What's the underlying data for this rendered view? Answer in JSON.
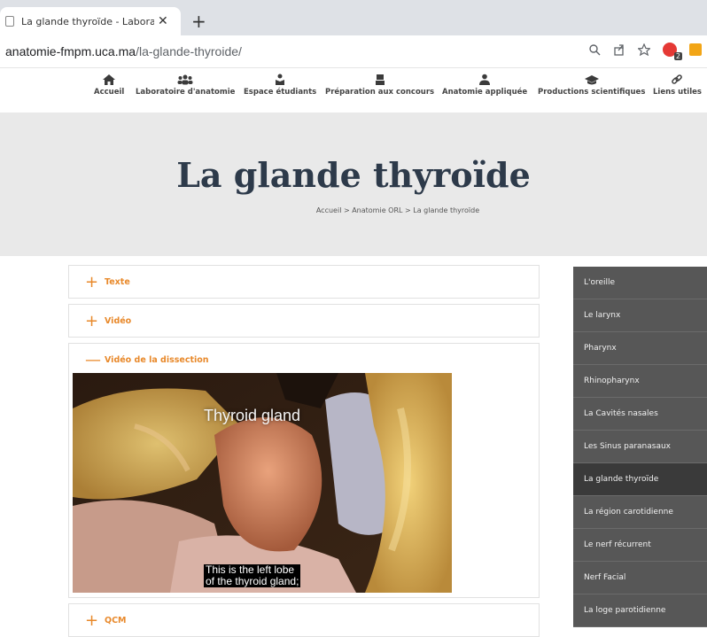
{
  "browser": {
    "tab_title": "La glande thyroïde - Laboratoire",
    "close_glyph": "✕",
    "new_tab_glyph": "+",
    "url_domain": "anatomie-fmpm.uca.ma",
    "url_path": "/la-glande-thyroide/",
    "ext_badge": "2"
  },
  "nav": {
    "items": [
      {
        "label": "Accueil",
        "icon": "home-icon"
      },
      {
        "label": "Laboratoire d'anatomie",
        "icon": "group-icon"
      },
      {
        "label": "Espace étudiants",
        "icon": "student-icon"
      },
      {
        "label": "Préparation aux concours",
        "icon": "exam-icon"
      },
      {
        "label": "Anatomie appliquée",
        "icon": "doctor-icon"
      },
      {
        "label": "Productions scientifiques",
        "icon": "graduation-cap-icon"
      },
      {
        "label": "Liens utiles",
        "icon": "link-icon"
      }
    ]
  },
  "hero": {
    "title": "La glande thyroïde",
    "breadcrumb": "Accueil > Anatomie ORL > La glande thyroïde"
  },
  "accordion": [
    {
      "sign": "+",
      "label": "Texte"
    },
    {
      "sign": "+",
      "label": "Vidéo"
    },
    {
      "sign": "—",
      "label": "Vidéo de la dissection"
    },
    {
      "sign": "+",
      "label": "QCM"
    }
  ],
  "video": {
    "caption_top": "Thyroid gland",
    "caption_line1": "This is the left lobe",
    "caption_line2": "of the thyroid gland;"
  },
  "sidebar": {
    "items": [
      "L'oreille",
      "Le larynx",
      "Pharynx",
      "Rhinopharynx",
      "La Cavités nasales",
      "Les Sinus paranasaux",
      "La glande thyroïde",
      "La région carotidienne",
      "Le nerf récurrent",
      "Nerf Facial",
      "La loge parotidienne"
    ],
    "active_index": 6
  },
  "colors": {
    "accent": "#e8892b",
    "sidebar_bg": "#575757",
    "sidebar_active": "#3a3a3a",
    "hero_bg": "#e9e9e9",
    "title_color": "#2d3a4a"
  }
}
